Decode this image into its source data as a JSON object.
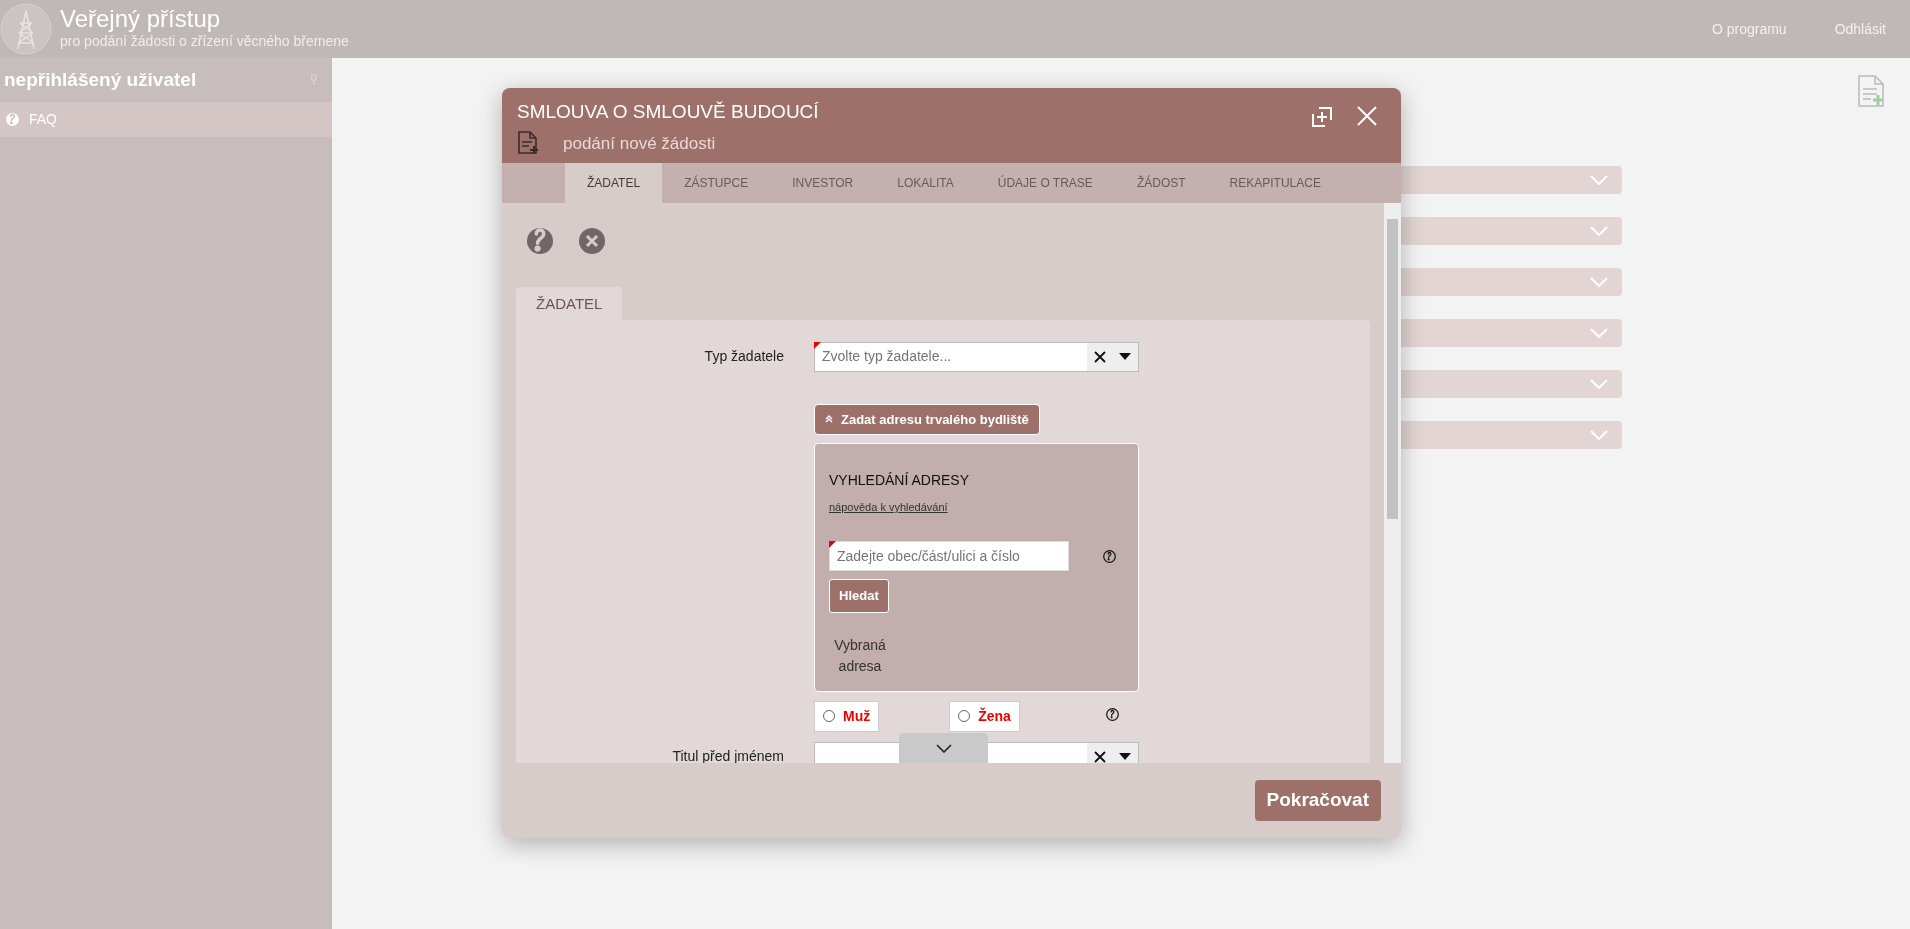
{
  "header": {
    "title": "Veřejný přístup",
    "subtitle": "pro podání žádosti o zřízení věcného břemene",
    "links": [
      {
        "label": "O programu"
      },
      {
        "label": "Odhlásit"
      }
    ]
  },
  "sidebar": {
    "user_label": "nepřihlášený uživatel",
    "items": [
      {
        "label": "FAQ",
        "selected": true
      }
    ]
  },
  "background_panels": [
    {
      "expanded": false
    },
    {
      "expanded": false
    },
    {
      "expanded": false
    },
    {
      "expanded": false
    },
    {
      "expanded": false
    },
    {
      "expanded": false
    }
  ],
  "dialog": {
    "title": "SMLOUVA O SMLOUVĚ BUDOUCÍ",
    "subtitle": "podání nové žádosti",
    "tabs": [
      {
        "label": "ŽADATEL",
        "selected": true
      },
      {
        "label": "ZÁSTUPCE",
        "selected": false
      },
      {
        "label": "INVESTOR",
        "selected": false
      },
      {
        "label": "LOKALITA",
        "selected": false
      },
      {
        "label": "ÚDAJE O TRASE",
        "selected": false
      },
      {
        "label": "ŽÁDOST",
        "selected": false
      },
      {
        "label": "REKAPITULACE",
        "selected": false
      }
    ],
    "section_tab": "ŽADATEL",
    "applicant_type": {
      "label": "Typ žadatele",
      "placeholder": "Zvolte typ žadatele...",
      "required": true
    },
    "address_button": "Zadat adresu trvalého bydliště",
    "address_search": {
      "heading": "VYHLEDÁNÍ ADRESY",
      "help_link": "nápověda k vyhledávání",
      "placeholder": "Zadejte obec/část/ulici a číslo",
      "required": true,
      "search_button": "Hledat",
      "selected_address_label": "Vybraná adresa"
    },
    "gender_options": [
      {
        "label": "Muž",
        "selected": false
      },
      {
        "label": "Žena",
        "selected": false
      }
    ],
    "title_before": {
      "label": "Titul před jménem"
    },
    "continue_button": "Pokračovat"
  }
}
